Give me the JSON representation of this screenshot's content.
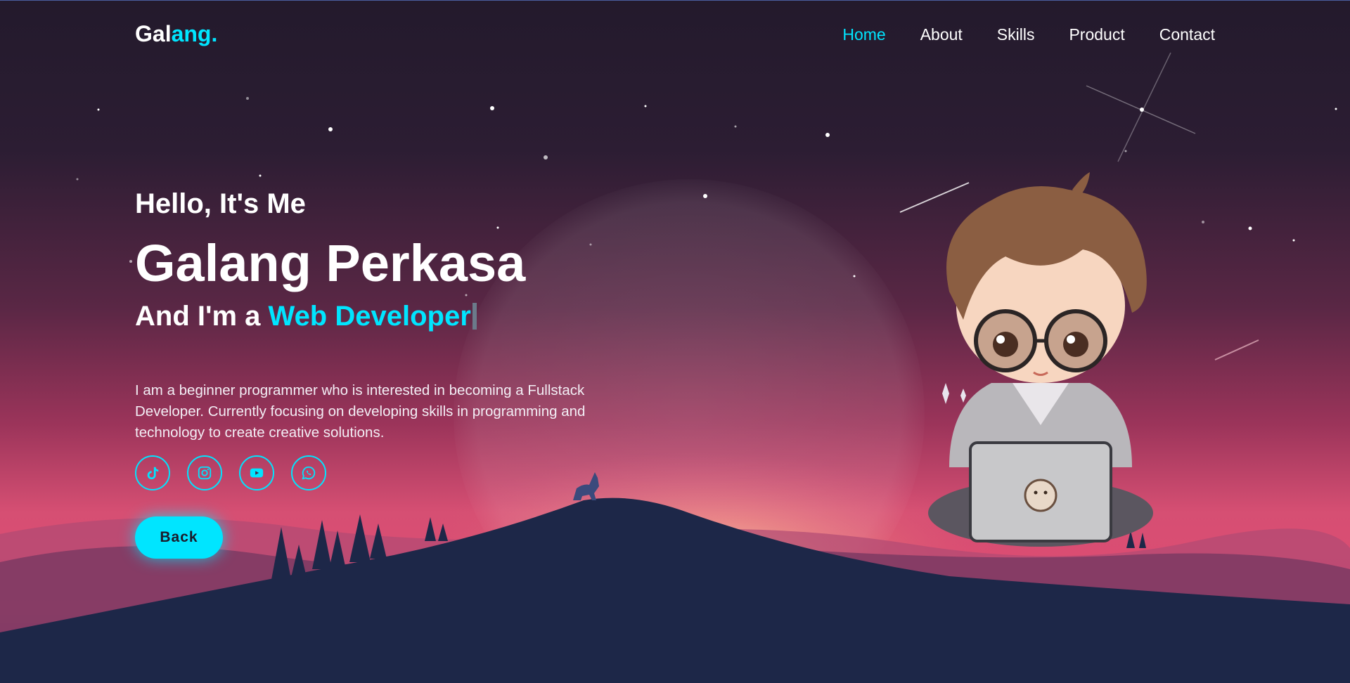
{
  "header": {
    "logo_main": "Gal",
    "logo_accent": "ang.",
    "nav": [
      {
        "label": "Home",
        "active": true
      },
      {
        "label": "About"
      },
      {
        "label": "Skills"
      },
      {
        "label": "Product"
      },
      {
        "label": "Contact"
      }
    ]
  },
  "hero": {
    "greeting": "Hello, It's Me",
    "name": "Galang Perkasa",
    "role_prefix": "And I'm a ",
    "role_typed": "Web Developer",
    "description": "I am a beginner programmer who is interested in becoming a Fullstack Developer. Currently focusing on developing skills in programming and technology to create creative solutions.",
    "socials": [
      {
        "icon": "tiktok-icon"
      },
      {
        "icon": "instagram-icon"
      },
      {
        "icon": "youtube-icon"
      },
      {
        "icon": "whatsapp-icon"
      }
    ],
    "back_label": "Back"
  },
  "colors": {
    "accent": "#00e5ff",
    "bg_top": "#231a2c",
    "bg_glow": "#d73b6e",
    "mountain": "#1d2748"
  }
}
